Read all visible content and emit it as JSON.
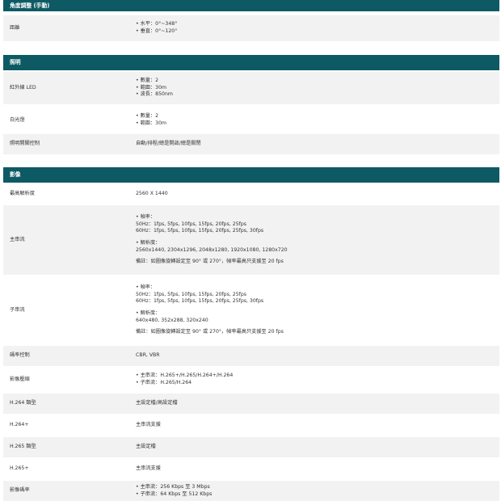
{
  "sections": {
    "angle": {
      "title": "角度調整 (手動)",
      "rows": [
        {
          "label": "距離",
          "lines": [
            "• 水平：0°~348°",
            "• 垂直：0°~120°"
          ]
        }
      ]
    },
    "lighting": {
      "title": "照明",
      "rows": [
        {
          "label": "紅外線 LED",
          "lines": [
            "• 數量：2",
            "• 範圍：30m",
            "• 波長：850nm"
          ]
        },
        {
          "label": "白光燈",
          "lines": [
            "• 數量：2",
            "• 範圍：30m"
          ]
        },
        {
          "label": "照明開關控制",
          "lines": [
            "自動/排程/總是開啟/總是關閉"
          ]
        }
      ]
    },
    "video": {
      "title": "影像",
      "rows": [
        {
          "label": "最高解析度",
          "lines": [
            "2560 X 1440"
          ]
        },
        {
          "label": "主串流",
          "lines": [
            "• 幀率：",
            "50Hz：1fps, 5fps, 10fps, 15fps, 20fps, 25fps",
            "60Hz：1fps, 5fps, 10fps, 15fps, 20fps, 25fps, 30fps"
          ],
          "lines2": [
            "• 解析度：",
            "2560x1440, 2304x1296, 2048x1280, 1920x1080, 1280x720"
          ],
          "note": "備註：如圖像旋轉設定至 90° 或 270°，幀率最高只支援至 20 fps"
        },
        {
          "label": "子串流",
          "lines": [
            "• 幀率：",
            "50Hz：1fps, 5fps, 10fps, 15fps, 20fps, 25fps",
            "60Hz：1fps, 5fps, 10fps, 15fps, 20fps, 25fps, 30fps"
          ],
          "lines2": [
            "• 解析度：",
            "640x480, 352x288, 320x240"
          ],
          "note": "備註：如圖像旋轉設定至 90° 或 270°，幀率最高只支援至 20 fps"
        },
        {
          "label": "碼率控制",
          "lines": [
            "CBR, VBR"
          ]
        },
        {
          "label": "影像壓縮",
          "lines": [
            "• 主串流：H.265+/H.265/H.264+/H.264",
            "• 子串流：H.265/H.264"
          ]
        },
        {
          "label": "H.264 類型",
          "lines": [
            "主設定檔/高設定檔"
          ]
        },
        {
          "label": "H.264+",
          "lines": [
            "主串流支援"
          ]
        },
        {
          "label": "H.265 類型",
          "lines": [
            "主設定檔"
          ]
        },
        {
          "label": "H.265+",
          "lines": [
            "主串流支援"
          ]
        },
        {
          "label": "影像碼率",
          "lines": [
            "• 主串流：256 Kbps 至 3 Mbps",
            "• 子串流：64 Kbps 至 512 Kbps"
          ]
        }
      ]
    }
  }
}
